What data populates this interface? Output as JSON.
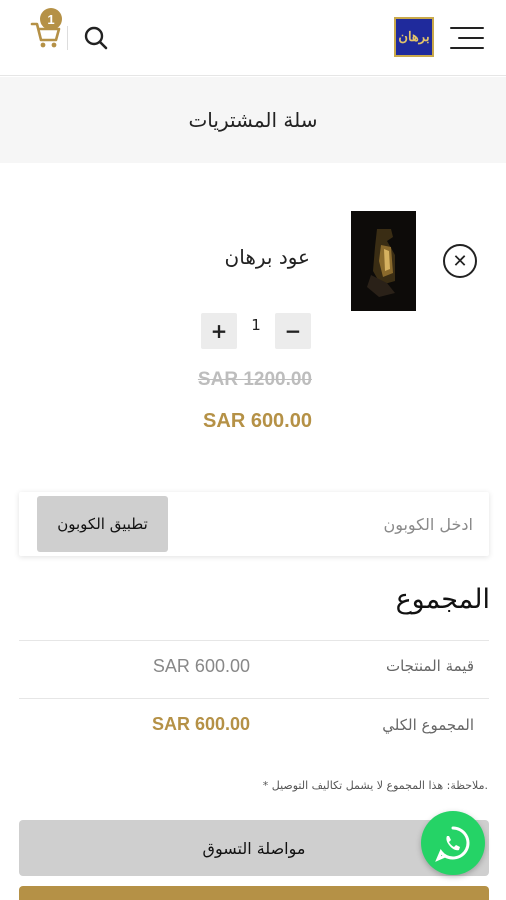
{
  "header": {
    "cart_count": "1",
    "logo_text": "برهان"
  },
  "page_title": "سلة المشتريات",
  "cart_item": {
    "name": "عود برهان",
    "quantity": "1",
    "minus_label": "−",
    "plus_label": "+",
    "old_price": "SAR 1200.00",
    "price": "SAR 600.00",
    "remove_label": "✕"
  },
  "coupon": {
    "placeholder": "ادخل الكوبون",
    "apply_label": "تطبيق الكوبون"
  },
  "totals": {
    "title": "المجموع",
    "subtotal_label": "قيمة المنتجات",
    "subtotal_value": "SAR 600.00",
    "total_label": "المجموع الكلي",
    "total_value": "SAR 600.00",
    "note": "* ملاحظة: هذا المجموع لا يشمل تكاليف التوصيل."
  },
  "actions": {
    "continue_label": "مواصلة التسوق"
  },
  "colors": {
    "accent": "#b59146",
    "whatsapp": "#25d366",
    "button_gray": "#cfcfcf"
  },
  "icons": [
    "menu-icon",
    "search-icon",
    "cart-icon",
    "close-icon",
    "whatsapp-icon"
  ]
}
